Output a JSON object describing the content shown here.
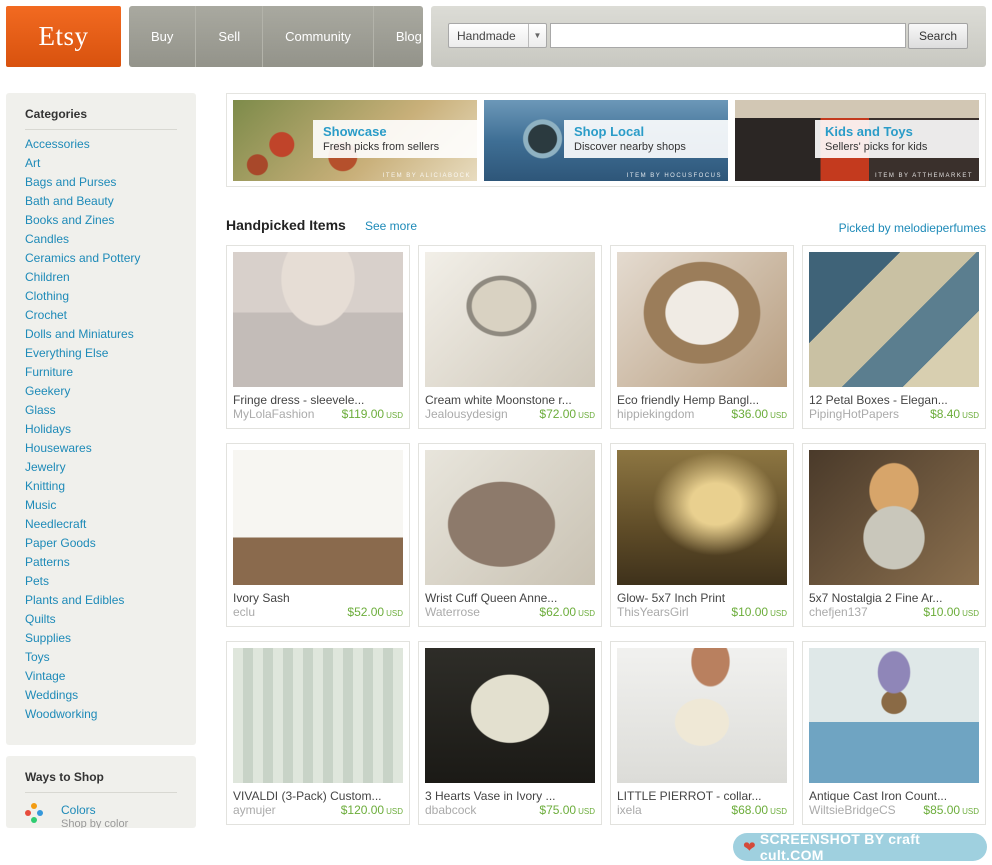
{
  "header": {
    "logo": "Etsy",
    "nav": [
      "Buy",
      "Sell",
      "Community",
      "Blog"
    ],
    "search": {
      "category": "Handmade",
      "value": "",
      "button": "Search"
    }
  },
  "sidebar": {
    "categories_title": "Categories",
    "categories": [
      "Accessories",
      "Art",
      "Bags and Purses",
      "Bath and Beauty",
      "Books and Zines",
      "Candles",
      "Ceramics and Pottery",
      "Children",
      "Clothing",
      "Crochet",
      "Dolls and Miniatures",
      "Everything Else",
      "Furniture",
      "Geekery",
      "Glass",
      "Holidays",
      "Housewares",
      "Jewelry",
      "Knitting",
      "Music",
      "Needlecraft",
      "Paper Goods",
      "Patterns",
      "Pets",
      "Plants and Edibles",
      "Quilts",
      "Supplies",
      "Toys",
      "Vintage",
      "Weddings",
      "Woodworking"
    ],
    "ways_title": "Ways to Shop",
    "ways": [
      {
        "label": "Colors",
        "sub": "Shop by color"
      }
    ]
  },
  "banners": [
    {
      "title": "Showcase",
      "subtitle": "Fresh picks from sellers",
      "credit": "ITEM BY ALICIABOCK"
    },
    {
      "title": "Shop Local",
      "subtitle": "Discover nearby shops",
      "credit": "ITEM BY HOCUSFOCUS"
    },
    {
      "title": "Kids and Toys",
      "subtitle": "Sellers' picks for kids",
      "credit": "ITEM BY ATTHEMARKET"
    }
  ],
  "handpicked": {
    "title": "Handpicked Items",
    "see_more": "See more",
    "picked_by": "Picked by melodieperfumes",
    "items": [
      {
        "title": "Fringe dress - sleevele...",
        "shop": "MyLolaFashion",
        "price": "$119.00",
        "currency": "USD"
      },
      {
        "title": "Cream white Moonstone r...",
        "shop": "Jealousydesign",
        "price": "$72.00",
        "currency": "USD"
      },
      {
        "title": "Eco friendly Hemp Bangl...",
        "shop": "hippiekingdom",
        "price": "$36.00",
        "currency": "USD"
      },
      {
        "title": "12 Petal Boxes - Elegan...",
        "shop": "PipingHotPapers",
        "price": "$8.40",
        "currency": "USD"
      },
      {
        "title": "Ivory Sash",
        "shop": "eclu",
        "price": "$52.00",
        "currency": "USD"
      },
      {
        "title": "Wrist Cuff Queen Anne...",
        "shop": "Waterrose",
        "price": "$62.00",
        "currency": "USD"
      },
      {
        "title": "Glow- 5x7 Inch Print",
        "shop": "ThisYearsGirl",
        "price": "$10.00",
        "currency": "USD"
      },
      {
        "title": "5x7 Nostalgia 2 Fine Ar...",
        "shop": "chefjen137",
        "price": "$10.00",
        "currency": "USD"
      },
      {
        "title": "VIVALDI (3-Pack) Custom...",
        "shop": "aymujer",
        "price": "$120.00",
        "currency": "USD"
      },
      {
        "title": "3 Hearts Vase in Ivory ...",
        "shop": "dbabcock",
        "price": "$75.00",
        "currency": "USD"
      },
      {
        "title": "LITTLE PIERROT - collar...",
        "shop": "ixela",
        "price": "$68.00",
        "currency": "USD"
      },
      {
        "title": "Antique Cast Iron Count...",
        "shop": "WiltsieBridgeCS",
        "price": "$85.00",
        "currency": "USD"
      }
    ]
  },
  "watermark": "SCREENSHOT BY craft cult.COM"
}
